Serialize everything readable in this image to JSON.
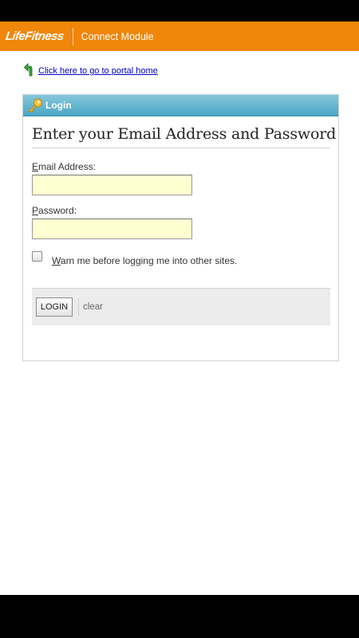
{
  "header": {
    "brand": "LifeFitness",
    "module_title": "Connect Module"
  },
  "portal_link": {
    "text": "Click here to go to portal home"
  },
  "panel": {
    "title": "Login",
    "heading": "Enter your Email Address and Password"
  },
  "form": {
    "email": {
      "label_accesskey": "E",
      "label_rest": "mail Address:",
      "value": ""
    },
    "password": {
      "label_accesskey": "P",
      "label_rest": "assword:",
      "value": ""
    },
    "warn_checkbox": {
      "label_accesskey": "W",
      "label_rest": "arn me before logging me into other sites.",
      "checked": false
    }
  },
  "buttons": {
    "login_label": "LOGIN",
    "clear_label": "clear"
  },
  "colors": {
    "header_bg": "#f0860a",
    "panel_header": "#4aa6c6",
    "field_bg": "#ffffd2",
    "link": "#0000cc"
  },
  "icons": {
    "back": "back-arrow-icon",
    "key": "key-icon"
  }
}
